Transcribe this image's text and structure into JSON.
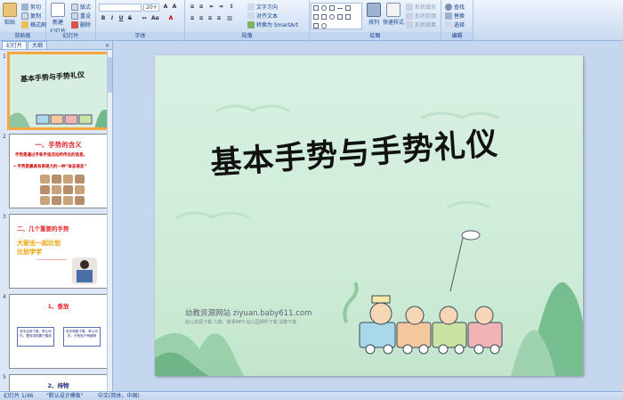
{
  "ribbon": {
    "clipboard": {
      "paste": "粘贴",
      "cut": "剪切",
      "copy": "复制",
      "format_painter": "格式刷",
      "label": "剪贴板"
    },
    "slides": {
      "new_slide": "新建",
      "new_slide_2": "幻灯片",
      "layout": "版式",
      "reset": "重设",
      "delete": "删除",
      "label": "幻灯片"
    },
    "font": {
      "size": "20+",
      "label": "字体"
    },
    "paragraph": {
      "text_direction": "文字方向",
      "align_text": "对齐文本",
      "smartart": "转换为 SmartArt",
      "label": "段落"
    },
    "drawing": {
      "arrange": "排列",
      "quick_styles": "快速样式",
      "fill": "形状填充",
      "outline": "形状轮廓",
      "effects": "形状效果",
      "label": "绘图"
    },
    "editing": {
      "find": "查找",
      "replace": "替换",
      "select": "选择",
      "label": "编辑"
    }
  },
  "leftpane": {
    "tab_slides": "幻灯片",
    "tab_outline": "大纲",
    "close": "×",
    "thumbs": [
      {
        "num": "1",
        "title": "基本手势与手势礼仪"
      },
      {
        "num": "2",
        "title": "一、手势的含义",
        "line1": "手势是通过手和手指活动所传达的信息。",
        "line2": "• 手势是最具有表现力的一种“体态语言”"
      },
      {
        "num": "3",
        "title": "二、几个重要的手势",
        "line1": "大家也一起比划",
        "line2": "比划学学"
      },
      {
        "num": "4",
        "title": "1、垂放",
        "box1": "双手自然下垂，掌心向内，叠放或相握于腹前",
        "box2": "双手伸直下垂，掌心向内，分别贴于两腿侧"
      },
      {
        "num": "5",
        "title": "2、持物"
      }
    ]
  },
  "slide": {
    "title": "基本手势与手势礼仪",
    "watermark": "幼教资源网站  ziyuan.baby611.com",
    "watermark_small": "幼儿资源下载  儿歌、故事MP3  幼儿园课件下载  试卷下载"
  },
  "statusbar": {
    "slide_pos": "幻灯片 1/46",
    "theme": "\"默认设计模板\"",
    "language": "中文(简体，中国)"
  },
  "colors": {
    "selected_thumb": "#f7a640",
    "slide_bg": "#d9f1e3",
    "thumb_title_red": "#e3262b"
  }
}
